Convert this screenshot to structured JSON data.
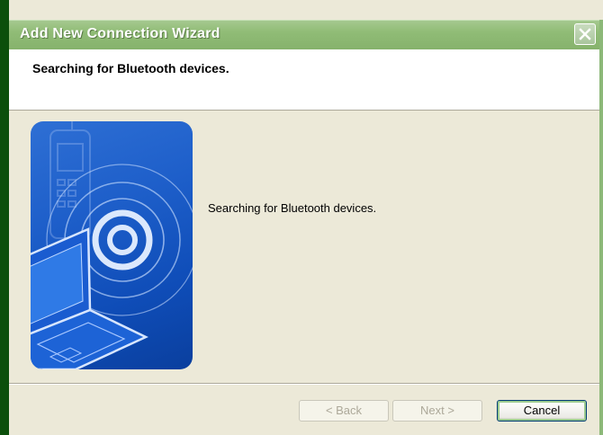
{
  "window": {
    "title": "Add New Connection Wizard"
  },
  "header": {
    "title": "Searching for Bluetooth devices."
  },
  "body": {
    "message": "Searching for Bluetooth devices."
  },
  "buttons": {
    "back": "< Back",
    "next": "Next >",
    "cancel": "Cancel"
  },
  "colors": {
    "titlebar": "#90bc76",
    "panel": "#ece9d8",
    "art_blue": "#1e5fca"
  },
  "icons": {
    "close": "close-icon",
    "art": "bluetooth-laptop-illustration"
  }
}
